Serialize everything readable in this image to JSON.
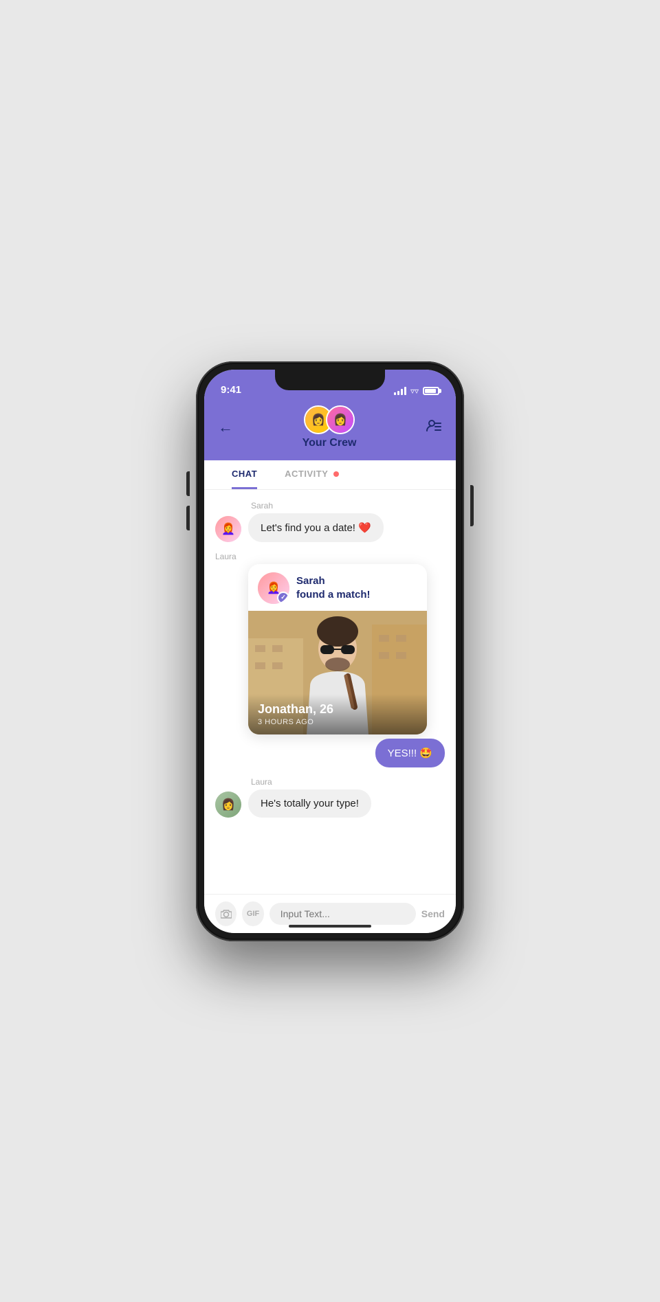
{
  "status_bar": {
    "time": "9:41",
    "battery_label": "battery"
  },
  "header": {
    "back_label": "←",
    "crew_name": "Your Crew",
    "contacts_icon": "👤≡"
  },
  "tabs": [
    {
      "id": "chat",
      "label": "CHAT",
      "active": true,
      "has_dot": false
    },
    {
      "id": "activity",
      "label": "ACTIVITY",
      "active": false,
      "has_dot": true
    }
  ],
  "messages": [
    {
      "id": "msg1",
      "sender": "Sarah",
      "type": "received",
      "text": "Let's find you a date! ❤️",
      "avatar": "sarah"
    },
    {
      "id": "msg2",
      "sender": "Laura",
      "type": "match-card",
      "card": {
        "match_text": "Sarah\nfound a match!",
        "person_name": "Jonathan, 26",
        "time_ago": "3 HOURS AGO"
      },
      "avatar": "laura"
    },
    {
      "id": "msg3",
      "type": "sent",
      "text": "YES!!! 🤩"
    },
    {
      "id": "msg4",
      "sender": "Laura",
      "type": "received",
      "text": "He's totally your type!",
      "avatar": "laura"
    }
  ],
  "input_bar": {
    "camera_label": "📷",
    "gif_label": "GIF",
    "placeholder": "Input Text...",
    "send_label": "Send"
  }
}
